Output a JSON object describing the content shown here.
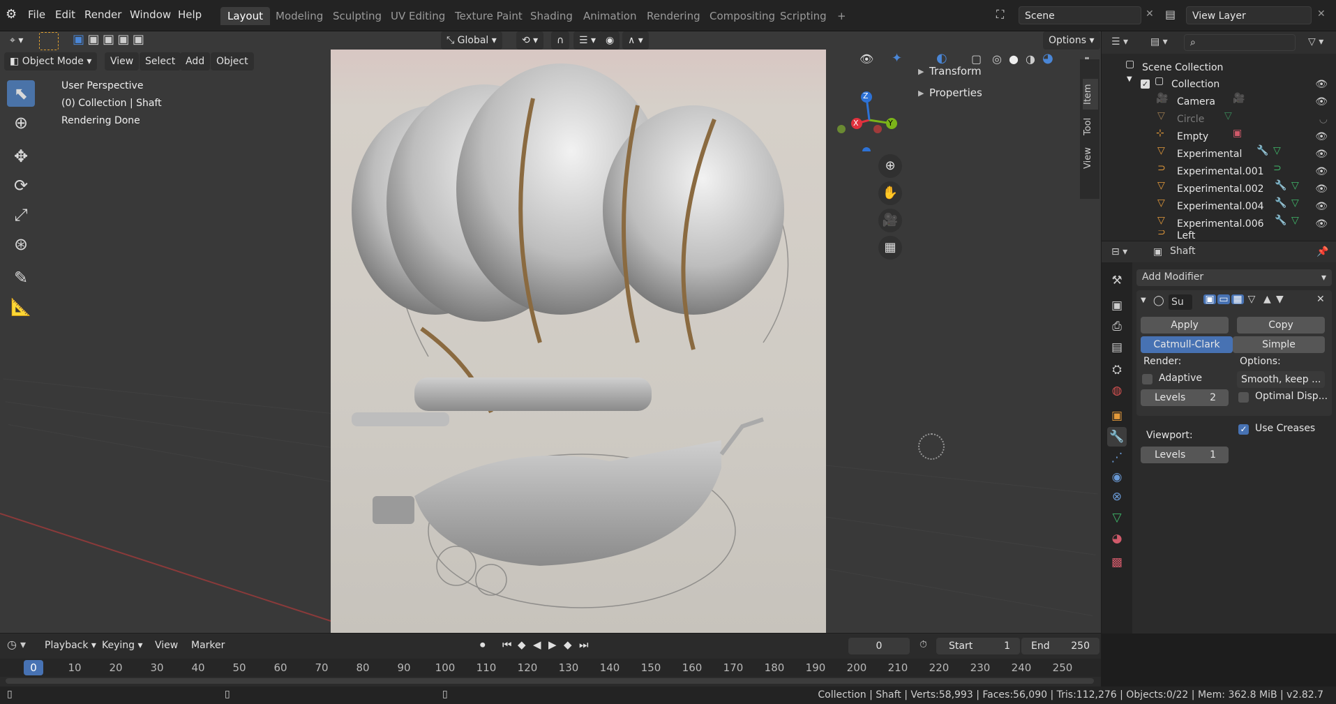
{
  "topbar": {
    "menus": [
      "File",
      "Edit",
      "Render",
      "Window",
      "Help"
    ],
    "workspaces": [
      "Layout",
      "Modeling",
      "Sculpting",
      "UV Editing",
      "Texture Paint",
      "Shading",
      "Animation",
      "Rendering",
      "Compositing",
      "Scripting"
    ],
    "active_workspace": "Layout",
    "add_tab": "+",
    "scene": "Scene",
    "view_layer": "View Layer"
  },
  "viewport": {
    "mode": "Object Mode",
    "menus": [
      "View",
      "Select",
      "Add",
      "Object"
    ],
    "transform_orientation": "Global",
    "options": "Options",
    "overlay_lines": [
      "User Perspective",
      "(0) Collection | Shaft",
      "Rendering Done"
    ],
    "npanel": [
      "Transform",
      "Properties"
    ],
    "side_tabs": [
      "Item",
      "Tool",
      "View"
    ],
    "gizmo_axes": {
      "x": "X",
      "y": "Y",
      "z": "Z"
    },
    "colors": {
      "x": "#e0313d",
      "y": "#7bb419",
      "z": "#2d72d6",
      "accent": "#4772b3"
    }
  },
  "outliner": {
    "root": "Scene Collection",
    "collection": "Collection",
    "items": [
      "Camera",
      "Circle",
      "Empty",
      "Experimental",
      "Experimental.001",
      "Experimental.002",
      "Experimental.004",
      "Experimental.006",
      "Left"
    ]
  },
  "properties": {
    "object": "Shaft",
    "add_modifier": "Add Modifier",
    "modifier_name": "Su",
    "apply": "Apply",
    "copy": "Copy",
    "catmull": "Catmull-Clark",
    "simple": "Simple",
    "render_label": "Render:",
    "options_label": "Options:",
    "adaptive": "Adaptive",
    "smooth": "Smooth, keep ...",
    "levels_label": "Levels",
    "render_levels": "2",
    "optimal": "Optimal Disp...",
    "use_creases": "Use Creases",
    "viewport_label": "Viewport:",
    "viewport_levels": "1"
  },
  "timeline": {
    "menus": [
      "Playback",
      "Keying",
      "View",
      "Marker"
    ],
    "current_frame": "0",
    "start_label": "Start",
    "start": "1",
    "end_label": "End",
    "end": "250",
    "ticks": [
      "0",
      "10",
      "20",
      "30",
      "40",
      "50",
      "60",
      "70",
      "80",
      "90",
      "100",
      "110",
      "120",
      "130",
      "140",
      "150",
      "160",
      "170",
      "180",
      "190",
      "200",
      "210",
      "220",
      "230",
      "240",
      "250"
    ]
  },
  "statusbar": {
    "text": "Collection | Shaft | Verts:58,993 | Faces:56,090 | Tris:112,276 | Objects:0/22 | Mem: 362.8 MiB | v2.82.7"
  }
}
